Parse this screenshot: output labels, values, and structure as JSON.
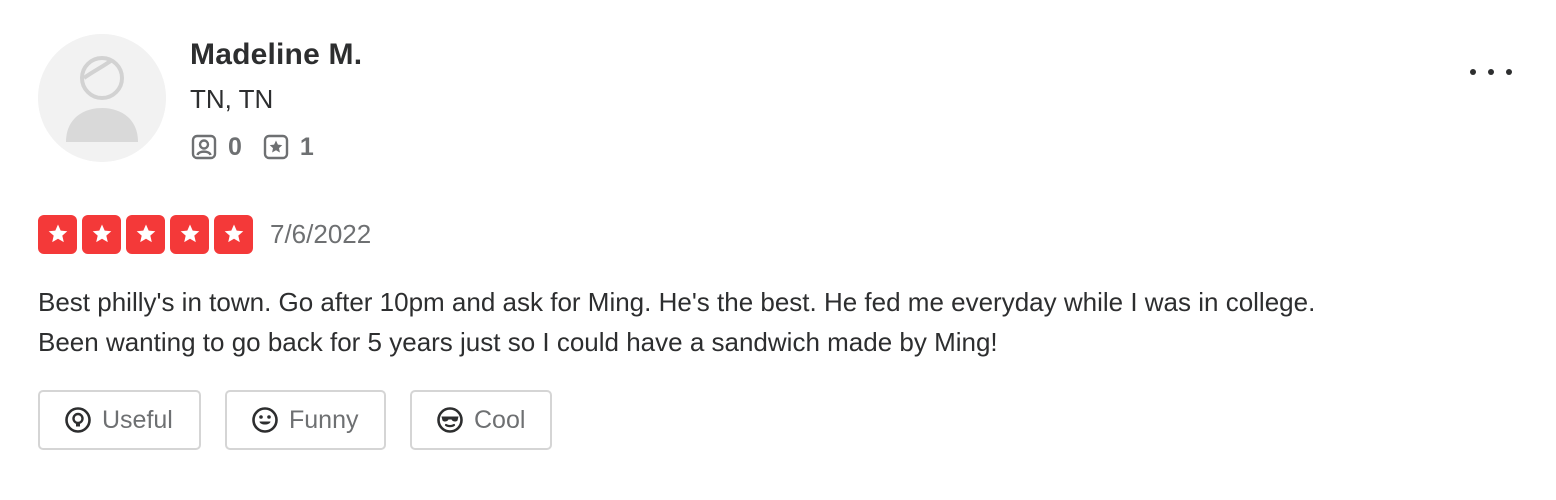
{
  "user": {
    "name": "Madeline M.",
    "location": "TN, TN",
    "stats": [
      {
        "icon": "friends-icon",
        "value": "0"
      },
      {
        "icon": "reviews-star-icon",
        "value": "1"
      }
    ]
  },
  "menu": {
    "icon": "more-options-icon"
  },
  "review": {
    "rating": 5,
    "rating_max": 5,
    "date": "7/6/2022",
    "text": "Best philly's in town. Go after 10pm and ask for Ming. He's the best. He fed me everyday while I was in college. Been wanting to go back for 5 years just so I could have a sandwich made by Ming!",
    "star_color": "#f43939"
  },
  "reactions": [
    {
      "icon": "lightbulb-icon",
      "label": "Useful"
    },
    {
      "icon": "smile-icon",
      "label": "Funny"
    },
    {
      "icon": "sunglasses-icon",
      "label": "Cool"
    }
  ]
}
